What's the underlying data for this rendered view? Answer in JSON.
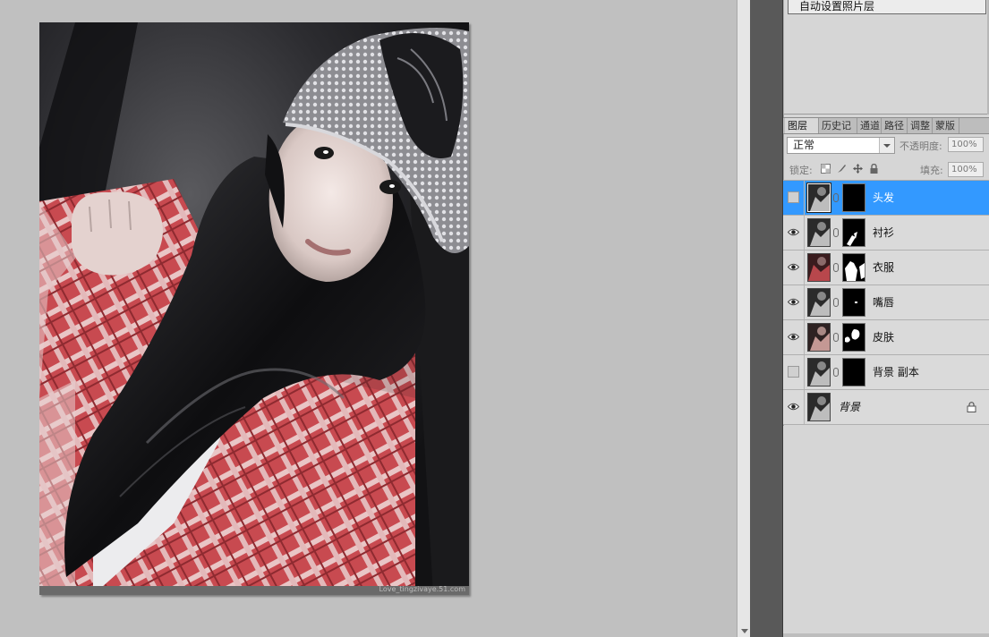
{
  "actions_panel": {
    "item_label": "自动设置照片层"
  },
  "photo": {
    "watermark": "Love_tingzivaye.51.com"
  },
  "layers_panel": {
    "tabs": [
      {
        "label": "图层",
        "active": true
      },
      {
        "label": "历史记",
        "active": false
      },
      {
        "label": "通道",
        "active": false
      },
      {
        "label": "路径",
        "active": false
      },
      {
        "label": "调整",
        "active": false
      },
      {
        "label": "蒙版",
        "active": false
      }
    ],
    "blend_mode": "正常",
    "opacity_label": "不透明度:",
    "opacity_value": "100%",
    "lock_label": "锁定:",
    "fill_label": "填充:",
    "fill_value": "100%",
    "layers": [
      {
        "name": "头发",
        "visible": false,
        "selected": true,
        "thumb": "gray",
        "mask": "black"
      },
      {
        "name": "衬衫",
        "visible": true,
        "selected": false,
        "thumb": "gray",
        "mask": "shirt"
      },
      {
        "name": "衣服",
        "visible": true,
        "selected": false,
        "thumb": "red",
        "mask": "clothes"
      },
      {
        "name": "嘴唇",
        "visible": true,
        "selected": false,
        "thumb": "gray",
        "mask": "lips"
      },
      {
        "name": "皮肤",
        "visible": true,
        "selected": false,
        "thumb": "warm",
        "mask": "skin"
      },
      {
        "name": "背景 副本",
        "visible": false,
        "selected": false,
        "thumb": "gray",
        "mask": "black"
      },
      {
        "name": "背景",
        "visible": true,
        "selected": false,
        "thumb": "gray",
        "mask": null,
        "locked": true
      }
    ]
  },
  "colors": {
    "selection": "#3399ff",
    "panel_bg": "#d6d6d6",
    "canvas_bg": "#c0c0c0"
  }
}
